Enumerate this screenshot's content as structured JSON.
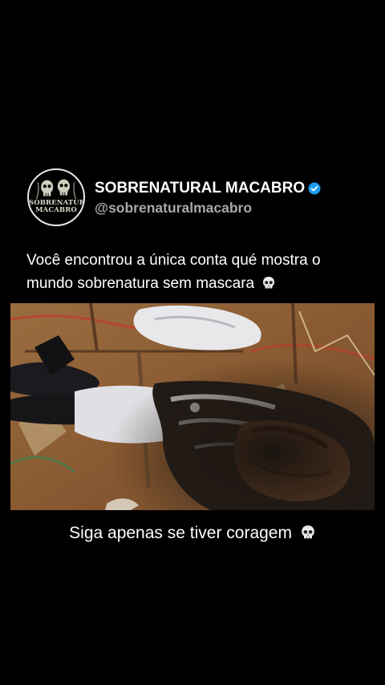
{
  "profile": {
    "avatar_text": [
      "SOBRENATURAL",
      "MACABRO"
    ],
    "display_name": "SOBRENATURAL MACABRO",
    "handle": "@sobrenaturalmacabro",
    "verified": true,
    "verified_color": "#1d9bf0"
  },
  "post": {
    "caption_line1": "Você encontrou a única conta qué mostra o",
    "caption_line2": "mundo sobrenatura sem mascara",
    "caption_emoji": "skull-icon"
  },
  "overlay": {
    "subtitle": "Siga apenas se tiver coragem",
    "subtitle_emoji": "skull-icon"
  }
}
